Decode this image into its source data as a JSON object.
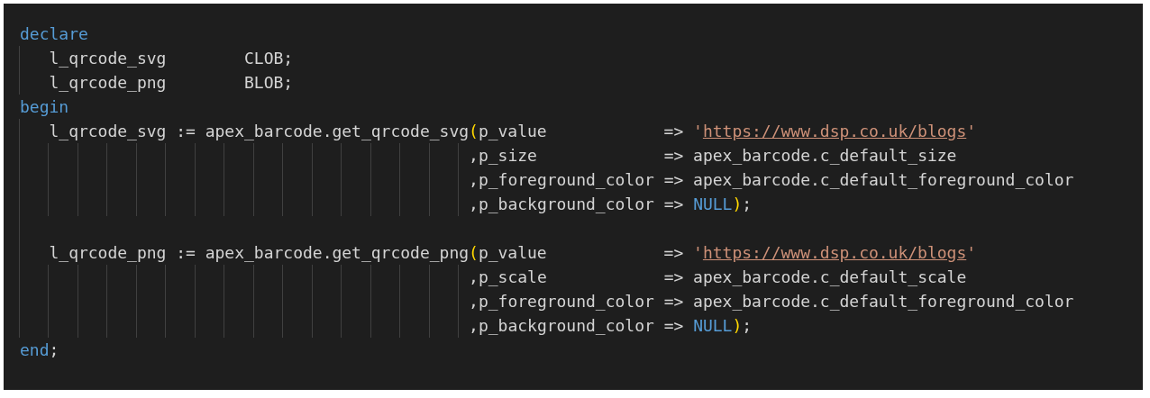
{
  "editor": {
    "lines": [
      {
        "kind": "code",
        "tokens": [
          {
            "kind": "keyword",
            "text": "declare"
          }
        ]
      },
      {
        "kind": "code",
        "tokens": [
          {
            "kind": "plain",
            "text": "   l_qrcode_svg        CLOB;"
          }
        ]
      },
      {
        "kind": "code",
        "tokens": [
          {
            "kind": "plain",
            "text": "   l_qrcode_png        BLOB;"
          }
        ]
      },
      {
        "kind": "code",
        "tokens": [
          {
            "kind": "keyword",
            "text": "begin"
          }
        ]
      },
      {
        "kind": "code",
        "tokens": [
          {
            "kind": "plain",
            "text": "   l_qrcode_svg := apex_barcode.get_qrcode_svg"
          },
          {
            "kind": "bracket",
            "text": "("
          },
          {
            "kind": "plain",
            "text": "p_value            => "
          },
          {
            "kind": "string",
            "text": "'"
          },
          {
            "kind": "link",
            "text": "https://www.dsp.co.uk/blogs"
          },
          {
            "kind": "string",
            "text": "'"
          }
        ]
      },
      {
        "kind": "code",
        "tokens": [
          {
            "kind": "plain",
            "text": "                                              ,p_size             => apex_barcode.c_default_size"
          }
        ]
      },
      {
        "kind": "code",
        "tokens": [
          {
            "kind": "plain",
            "text": "                                              ,p_foreground_color => apex_barcode.c_default_foreground_color"
          }
        ]
      },
      {
        "kind": "code",
        "tokens": [
          {
            "kind": "plain",
            "text": "                                              ,p_background_color => "
          },
          {
            "kind": "keyword",
            "text": "NULL"
          },
          {
            "kind": "bracket",
            "text": ")"
          },
          {
            "kind": "plain",
            "text": ";"
          }
        ]
      },
      {
        "kind": "blank"
      },
      {
        "kind": "code",
        "tokens": [
          {
            "kind": "plain",
            "text": "   l_qrcode_png := apex_barcode.get_qrcode_png"
          },
          {
            "kind": "bracket",
            "text": "("
          },
          {
            "kind": "plain",
            "text": "p_value            => "
          },
          {
            "kind": "string",
            "text": "'"
          },
          {
            "kind": "link",
            "text": "https://www.dsp.co.uk/blogs"
          },
          {
            "kind": "string",
            "text": "'"
          }
        ]
      },
      {
        "kind": "code",
        "tokens": [
          {
            "kind": "plain",
            "text": "                                              ,p_scale            => apex_barcode.c_default_scale"
          }
        ]
      },
      {
        "kind": "code",
        "tokens": [
          {
            "kind": "plain",
            "text": "                                              ,p_foreground_color => apex_barcode.c_default_foreground_color"
          }
        ]
      },
      {
        "kind": "code",
        "tokens": [
          {
            "kind": "plain",
            "text": "                                              ,p_background_color => "
          },
          {
            "kind": "keyword",
            "text": "NULL"
          },
          {
            "kind": "bracket",
            "text": ")"
          },
          {
            "kind": "plain",
            "text": ";"
          }
        ]
      },
      {
        "kind": "code",
        "tokens": [
          {
            "kind": "keyword",
            "text": "end"
          },
          {
            "kind": "plain",
            "text": ";"
          }
        ]
      }
    ]
  }
}
